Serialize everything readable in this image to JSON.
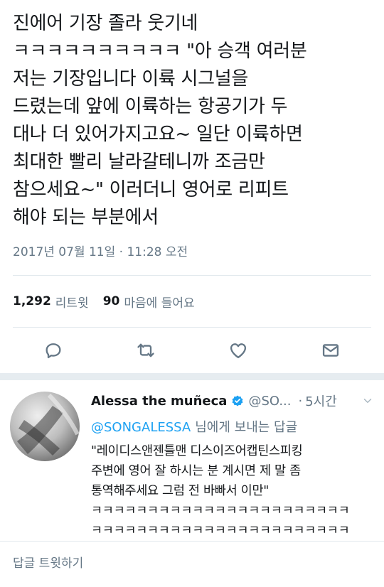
{
  "tweet": {
    "text": "진에어 기장 졸라 웃기네\nㅋㅋㅋㅋㅋㅋㅋㅋㅋㅋ \"아 승객 여러분\n저는 기장입니다 이륙 시그널을\n드렸는데 앞에 이륙하는 항공기가 두\n대나 더 있어가지고요~ 일단 이륙하면\n최대한 빨리 날라갈테니까 조금만\n참으세요~\" 이러더니 영어로 리피트\n해야 되는 부분에서",
    "timestamp": "2017년 07월 11일 · 11:28 오전"
  },
  "stats": {
    "retweets_count": "1,292",
    "retweets_label": "리트윗",
    "likes_count": "90",
    "likes_label": "마음에 들어요"
  },
  "actions": {
    "icons": [
      "reply-icon",
      "retweet-icon",
      "like-icon",
      "message-icon"
    ],
    "icon_color": "#657786"
  },
  "reply": {
    "name": "Alessa the muñeca",
    "handle": "@SO...",
    "dot": "·",
    "time": "5시간",
    "replying_to_handle": "@SONGALESSA",
    "replying_to_suffix": "님에게 보내는 답글",
    "text": "\"레이디스앤젠틀맨 디스이즈어캡틴스피킹\n주변에 영어 잘 하시는 분 계시면 제 말 좀\n통역해주세요 그럼 전 바빠서 이만\"\nㅋㅋㅋㅋㅋㅋㅋㅋㅋㅋㅋㅋㅋㅋㅋㅋㅋㅋㅋㅋㅋㅋㅋ\nㅋㅋㅋㅋㅋㅋㅋㅋㅋㅋㅋㅋㅋㅋㅋㅋㅋㅋㅋㅋㅋㅋㅋ"
  },
  "compose": {
    "placeholder": "답글 트윗하기"
  },
  "colors": {
    "link": "#1da1f2",
    "secondary_text": "#657786",
    "verified": "#1da1f2"
  }
}
